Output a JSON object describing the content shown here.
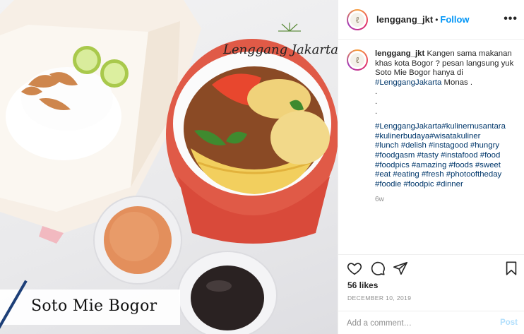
{
  "post": {
    "image_overlay_title": "Soto Mie Bogor",
    "image_brand": "Lenggang Jakarta",
    "account": {
      "username": "lenggang_jkt",
      "separator": "•",
      "follow_label": "Follow",
      "more_label": "•••"
    },
    "caption": {
      "username": "lenggang_jkt",
      "text": "Kangen sama makanan khas kota Bogor ? pesan langsung yuk Soto Mie Bogor hanya di",
      "location_tag": "#LenggangJakarta",
      "text_after": "Monas .",
      "dots": [
        ".",
        ".",
        "."
      ],
      "hashtag_lines": [
        "#LenggangJakarta#kulinernusantara",
        "#kulinerbudaya#wisatakuliner",
        "#lunch #delish #instagood #hungry",
        "#foodgasm #tasty #instafood #food",
        "#foodpics #amazing #foods #sweet",
        "#eat #eating #fresh #photooftheday",
        "#foodie #foodpic #dinner"
      ],
      "age": "6w"
    },
    "likes": "56 likes",
    "date": "DECEMBER 10, 2019",
    "comment_placeholder": "Add a comment…",
    "post_button": "Post",
    "icons": [
      "heart-icon",
      "comment-icon",
      "share-icon",
      "bookmark-icon"
    ],
    "colors": {
      "link": "#00376b",
      "follow": "#0095f6",
      "muted": "#8e8e8e",
      "post_disabled": "#b2dffc"
    }
  }
}
